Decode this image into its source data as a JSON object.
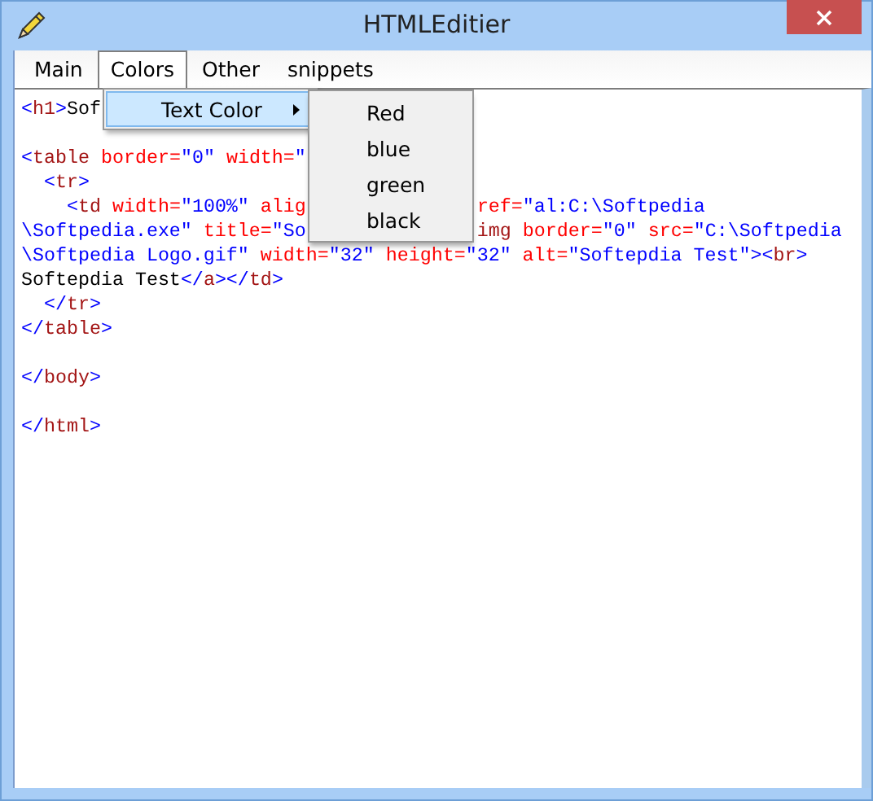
{
  "window": {
    "title": "HTMLEditier"
  },
  "menu_bar": [
    {
      "label": "Main",
      "selected": false
    },
    {
      "label": "Colors",
      "selected": true
    },
    {
      "label": "Other",
      "selected": false
    },
    {
      "label": "snippets",
      "selected": false
    }
  ],
  "dropdown": {
    "items": [
      {
        "label": "Text Color",
        "highlighted": true,
        "has_submenu": true
      }
    ]
  },
  "submenu": {
    "items": [
      {
        "label": "Red"
      },
      {
        "label": "blue"
      },
      {
        "label": "green"
      },
      {
        "label": "black"
      }
    ]
  },
  "editor": {
    "lines": [
      {
        "kind": "code",
        "parts": [
          [
            {
              "t": "<",
              "kind": "bracket"
            },
            {
              "t": "h1",
              "kind": "tag"
            },
            {
              "t": ">",
              "kind": "bracket"
            },
            {
              "t": "Sof",
              "kind": "text"
            }
          ]
        ]
      },
      {
        "kind": "blank"
      },
      {
        "kind": "code",
        "parts": [
          [
            {
              "t": "<",
              "kind": "bracket"
            },
            {
              "t": "table",
              "kind": "tag"
            },
            {
              "t": " border=",
              "kind": "attr"
            },
            {
              "t": "\"0\"",
              "kind": "value"
            },
            {
              "t": " width=",
              "kind": "attr"
            },
            {
              "t": "\"",
              "kind": "value"
            }
          ]
        ]
      },
      {
        "kind": "code",
        "parts": [
          [
            {
              "t": "  <",
              "kind": "bracket"
            },
            {
              "t": "tr",
              "kind": "tag"
            },
            {
              "t": ">",
              "kind": "bracket"
            }
          ]
        ]
      },
      {
        "kind": "code",
        "parts": [
          [
            {
              "t": "    <",
              "kind": "bracket"
            },
            {
              "t": "td",
              "kind": "tag"
            },
            {
              "t": " width=",
              "kind": "attr"
            },
            {
              "t": "\"100%\"",
              "kind": "value"
            },
            {
              "t": " alig",
              "kind": "attr"
            }
          ],
          [
            {
              "t": "ref=",
              "kind": "attr"
            },
            {
              "t": "\"al:C:\\Softpedia",
              "kind": "value"
            }
          ]
        ]
      },
      {
        "kind": "code",
        "parts": [
          [
            {
              "t": "\\Softpedia.exe\"",
              "kind": "value"
            },
            {
              "t": " title=",
              "kind": "attr"
            },
            {
              "t": "\"So",
              "kind": "value"
            }
          ],
          [
            {
              "t": "img",
              "kind": "tag"
            },
            {
              "t": " border=",
              "kind": "attr"
            },
            {
              "t": "\"0\"",
              "kind": "value"
            },
            {
              "t": " src=",
              "kind": "attr"
            },
            {
              "t": "\"C:\\Softpedia",
              "kind": "value"
            }
          ]
        ]
      },
      {
        "kind": "code",
        "parts": [
          [
            {
              "t": "\\Softpedia Logo.gif\"",
              "kind": "value"
            },
            {
              "t": " width=",
              "kind": "attr"
            },
            {
              "t": "\"32\"",
              "kind": "value"
            },
            {
              "t": " height=",
              "kind": "attr"
            },
            {
              "t": "\"32\"",
              "kind": "value"
            },
            {
              "t": " alt=",
              "kind": "attr"
            },
            {
              "t": "\"Softepdia Test\"",
              "kind": "value"
            },
            {
              "t": "><",
              "kind": "bracket"
            },
            {
              "t": "br",
              "kind": "tag"
            },
            {
              "t": ">",
              "kind": "bracket"
            }
          ]
        ]
      },
      {
        "kind": "code",
        "parts": [
          [
            {
              "t": "Softepdia Test",
              "kind": "text"
            },
            {
              "t": "</",
              "kind": "bracket"
            },
            {
              "t": "a",
              "kind": "tag"
            },
            {
              "t": "></",
              "kind": "bracket"
            },
            {
              "t": "td",
              "kind": "tag"
            },
            {
              "t": ">",
              "kind": "bracket"
            }
          ]
        ]
      },
      {
        "kind": "code",
        "parts": [
          [
            {
              "t": "  </",
              "kind": "bracket"
            },
            {
              "t": "tr",
              "kind": "tag"
            },
            {
              "t": ">",
              "kind": "bracket"
            }
          ]
        ]
      },
      {
        "kind": "code",
        "parts": [
          [
            {
              "t": "</",
              "kind": "bracket"
            },
            {
              "t": "table",
              "kind": "tag"
            },
            {
              "t": ">",
              "kind": "bracket"
            }
          ]
        ]
      },
      {
        "kind": "blank"
      },
      {
        "kind": "code",
        "parts": [
          [
            {
              "t": "</",
              "kind": "bracket"
            },
            {
              "t": "body",
              "kind": "tag"
            },
            {
              "t": ">",
              "kind": "bracket"
            }
          ]
        ]
      },
      {
        "kind": "blank"
      },
      {
        "kind": "code",
        "parts": [
          [
            {
              "t": "</",
              "kind": "bracket"
            },
            {
              "t": "html",
              "kind": "tag"
            },
            {
              "t": ">",
              "kind": "bracket"
            }
          ]
        ]
      }
    ]
  }
}
